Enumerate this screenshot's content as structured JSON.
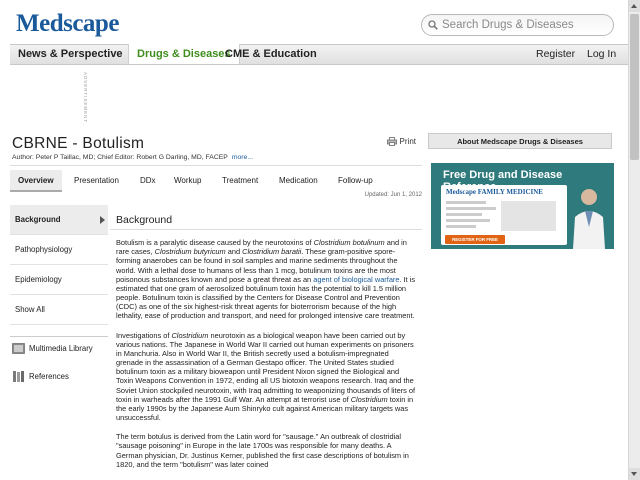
{
  "header": {
    "logo": "Medscape",
    "search_placeholder": "Search Drugs & Diseases"
  },
  "nav": {
    "items": [
      "News & Perspective",
      "Drugs & Diseases",
      "CME & Education"
    ],
    "register": "Register",
    "login": "Log In"
  },
  "advertisement_label": "ADVERTISEMENT",
  "article": {
    "title": "CBRNE - Botulism",
    "authors": "Author: Peter P Taillac, MD; Chief Editor: Robert G Darling, MD, FACEP",
    "more": "more...",
    "print": "Print",
    "updated": "Updated: Jun 1, 2012"
  },
  "tabs": [
    "Overview",
    "Presentation",
    "DDx",
    "Workup",
    "Treatment",
    "Medication",
    "Follow-up"
  ],
  "sidenav": {
    "items": [
      "Background",
      "Pathophysiology",
      "Epidemiology",
      "Show All"
    ],
    "multimedia": "Multimedia Library",
    "references": "References"
  },
  "section": {
    "title": "Background",
    "p1_a": "Botulism is a paralytic disease caused by the neurotoxins of ",
    "p1_i1": "Clostridium botulinum",
    "p1_b": " and in rare cases, ",
    "p1_i2": "Clostridium butyricum",
    "p1_c": " and ",
    "p1_i3": "Clostridium baratii",
    "p1_d": ". These gram-positive spore-forming anaerobes can be found in soil samples and marine sediments throughout the world. With a lethal dose to humans of less than 1 mcg, botulinum toxins are the most poisonous substances known and pose a great threat as an ",
    "p1_link": "agent of biological warfare",
    "p1_e": ". It is estimated that one gram of aerosolized botulinum toxin has the potential to kill 1.5 million people. Botulinum toxin is classified by the Centers for Disease Control and Prevention (CDC) as one of the six highest-risk threat agents for bioterrorism because of the high lethality, ease of production and transport, and need for prolonged intensive care treatment.",
    "p2_a": "Investigations of ",
    "p2_i1": "Clostridium",
    "p2_b": " neurotoxin as a biological weapon have been carried out by various nations. The Japanese in World War II carried out human experiments on prisoners in Manchuria. Also in World War II, the British secretly used a botulism-impregnated grenade in the assassination of a German Gestapo officer. The United States studied botulinum toxin as a military bioweapon until President Nixon signed the Biological and Toxin Weapons Convention in 1972, ending all US biotoxin weapons research. Iraq and the Soviet Union stockpiled neurotoxin, with Iraq admitting to weaponizing thousands of liters of toxin in warheads after the 1991 Gulf War. An attempt at terrorist use of ",
    "p2_i2": "Clostridium",
    "p2_c": " toxin in the early 1990s by the Japanese Aum Shinryko cult against American military targets was unsuccessful.",
    "p3": "The term botulus is derived from the Latin word for \"sausage.\" An outbreak of clostridial \"sausage poisoning\" in Europe in the late 1700s was responsible for many deaths. A German physician, Dr. Justinus Kerner, published the first case descriptions of botulism in 1820, and the term \"botulism\" was later coined"
  },
  "right": {
    "box_title": "About Medscape Drugs & Diseases",
    "ad_headline": "Free Drug and Disease Reference",
    "ad_brand": "Medscape FAMILY MEDICINE",
    "ad_button": "REGISTER FOR FREE"
  },
  "colors": {
    "brand_blue": "#1a5a9a",
    "nav_active_green": "#3e8e1e",
    "ad_teal": "#2f7a7c",
    "ad_button": "#e06414"
  }
}
